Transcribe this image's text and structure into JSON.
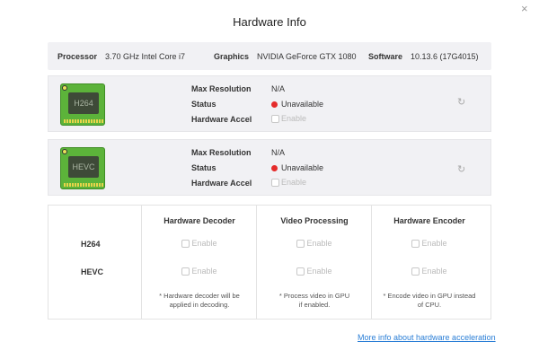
{
  "title": "Hardware Info",
  "close_icon": "×",
  "system": {
    "processor_label": "Processor",
    "processor": "3.70 GHz Intel Core i7",
    "graphics_label": "Graphics",
    "graphics": "NVIDIA GeForce GTX 1080",
    "software_label": "Software",
    "software": "10.13.6 (17G4015)"
  },
  "codecs": [
    {
      "chip": "H264",
      "max_res_label": "Max Resolution",
      "max_res": "N/A",
      "status_label": "Status",
      "status": "Unavailable",
      "accel_label": "Hardware Accel",
      "accel": "Enable"
    },
    {
      "chip": "HEVC",
      "max_res_label": "Max Resolution",
      "max_res": "N/A",
      "status_label": "Status",
      "status": "Unavailable",
      "accel_label": "Hardware Accel",
      "accel": "Enable"
    }
  ],
  "table": {
    "headers": [
      "Hardware Decoder",
      "Video Processing",
      "Hardware Encoder"
    ],
    "rows": [
      "H264",
      "HEVC"
    ],
    "enable": "Enable",
    "notes": [
      [
        "* Hardware decoder will be",
        "applied in decoding."
      ],
      [
        "* Process video in GPU",
        "if enabled."
      ],
      [
        "* Encode video in GPU instead",
        "of CPU."
      ]
    ]
  },
  "link": "More info about hardware acceleration",
  "colors": {
    "status_red": "#e52b2b",
    "link": "#2a7ed6"
  }
}
